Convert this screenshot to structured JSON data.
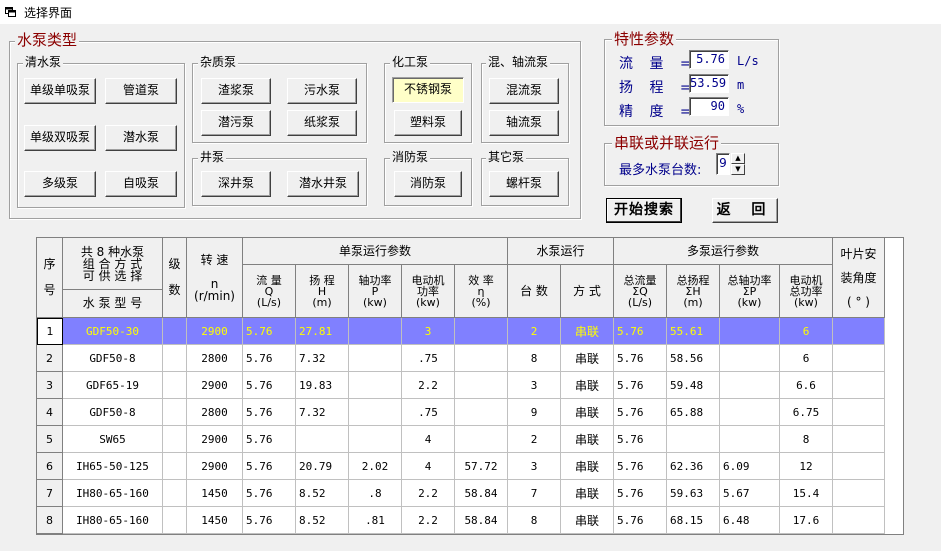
{
  "window": {
    "title": "选择界面"
  },
  "pump_type": {
    "title": "水泵类型",
    "groups": {
      "clear": {
        "label": "清水泵",
        "buttons": [
          "单级单吸泵",
          "管道泵",
          "单级双吸泵",
          "潜水泵",
          "多级泵",
          "自吸泵"
        ]
      },
      "impurity": {
        "label": "杂质泵",
        "buttons": [
          "渣浆泵",
          "污水泵",
          "潜污泵",
          "纸浆泵"
        ]
      },
      "chemical": {
        "label": "化工泵",
        "buttons": [
          "不锈钢泵",
          "塑料泵"
        ]
      },
      "mixed": {
        "label": "混、轴流泵",
        "buttons": [
          "混流泵",
          "轴流泵"
        ]
      },
      "well": {
        "label": "井泵",
        "buttons": [
          "深井泵",
          "潜水井泵"
        ]
      },
      "fire": {
        "label": "消防泵",
        "buttons": [
          "消防泵"
        ]
      },
      "other": {
        "label": "其它泵",
        "buttons": [
          "螺杆泵"
        ]
      }
    },
    "selected": "不锈钢泵"
  },
  "characteristics": {
    "title": "特性参数",
    "flow": {
      "label": "流 量 =",
      "value": "5.76",
      "unit": "L/s"
    },
    "head": {
      "label": "扬 程 =",
      "value": "53.59",
      "unit": "m"
    },
    "precision": {
      "label": "精 度 =",
      "value": "90",
      "unit": "%"
    }
  },
  "series": {
    "title": "串联或并联运行",
    "max_label": "最多水泵台数:",
    "max_value": "9"
  },
  "actions": {
    "search": "开始搜索",
    "back": "返 回"
  },
  "table": {
    "headers": {
      "seq": "序\n\n号",
      "combos": "共 8 种水泵\n组 合 方 式\n可 供 选 择",
      "model": "水 泵 型 号",
      "stage": "级\n\n数",
      "speed": "转  速\n\nn\n(r/min)",
      "single": "单泵运行参数",
      "flow": "流  量\nQ\n(L/s)",
      "head": "扬  程\nH\n(m)",
      "shaft": "轴功率\nP\n(kw)",
      "motor": "电动机\n功率\n(kw)",
      "eff": "效  率\nη\n(%)",
      "pumps": "水泵运行",
      "count": "台  数",
      "mode": "方  式",
      "multi": "多泵运行参数",
      "tflow": "总流量\nΣQ\n(L/s)",
      "thead": "总扬程\nΣH\n(m)",
      "tshaft": "总轴功率\nΣP\n(kw)",
      "tmotor": "电动机\n总功率\n(kw)",
      "blade": "叶片安\n\n装角度\n\n( ° )"
    },
    "rows": [
      {
        "n": "1",
        "model": "GDF50-30",
        "stage": "",
        "speed": "2900",
        "flow": "5.76",
        "head": "27.81",
        "shaft": "",
        "motor": "3",
        "eff": "",
        "count": "2",
        "mode": "串联",
        "tflow": "5.76",
        "thead": "55.61",
        "tshaft": "",
        "tmotor": "6",
        "blade": ""
      },
      {
        "n": "2",
        "model": "GDF50-8",
        "stage": "",
        "speed": "2800",
        "flow": "5.76",
        "head": "7.32",
        "shaft": "",
        "motor": ".75",
        "eff": "",
        "count": "8",
        "mode": "串联",
        "tflow": "5.76",
        "thead": "58.56",
        "tshaft": "",
        "tmotor": "6",
        "blade": ""
      },
      {
        "n": "3",
        "model": "GDF65-19",
        "stage": "",
        "speed": "2900",
        "flow": "5.76",
        "head": "19.83",
        "shaft": "",
        "motor": "2.2",
        "eff": "",
        "count": "3",
        "mode": "串联",
        "tflow": "5.76",
        "thead": "59.48",
        "tshaft": "",
        "tmotor": "6.6",
        "blade": ""
      },
      {
        "n": "4",
        "model": "GDF50-8",
        "stage": "",
        "speed": "2800",
        "flow": "5.76",
        "head": "7.32",
        "shaft": "",
        "motor": ".75",
        "eff": "",
        "count": "9",
        "mode": "串联",
        "tflow": "5.76",
        "thead": "65.88",
        "tshaft": "",
        "tmotor": "6.75",
        "blade": ""
      },
      {
        "n": "5",
        "model": "SW65",
        "stage": "",
        "speed": "2900",
        "flow": "5.76",
        "head": "",
        "shaft": "",
        "motor": "4",
        "eff": "",
        "count": "2",
        "mode": "串联",
        "tflow": "5.76",
        "thead": "",
        "tshaft": "",
        "tmotor": "8",
        "blade": ""
      },
      {
        "n": "6",
        "model": "IH65-50-125",
        "stage": "",
        "speed": "2900",
        "flow": "5.76",
        "head": "20.79",
        "shaft": "2.02",
        "motor": "4",
        "eff": "57.72",
        "count": "3",
        "mode": "串联",
        "tflow": "5.76",
        "thead": "62.36",
        "tshaft": "6.09",
        "tmotor": "12",
        "blade": ""
      },
      {
        "n": "7",
        "model": "IH80-65-160",
        "stage": "",
        "speed": "1450",
        "flow": "5.76",
        "head": "8.52",
        "shaft": ".8",
        "motor": "2.2",
        "eff": "58.84",
        "count": "7",
        "mode": "串联",
        "tflow": "5.76",
        "thead": "59.63",
        "tshaft": "5.67",
        "tmotor": "15.4",
        "blade": ""
      },
      {
        "n": "8",
        "model": "IH80-65-160",
        "stage": "",
        "speed": "1450",
        "flow": "5.76",
        "head": "8.52",
        "shaft": ".81",
        "motor": "2.2",
        "eff": "58.84",
        "count": "8",
        "mode": "串联",
        "tflow": "5.76",
        "thead": "68.15",
        "tshaft": "6.48",
        "tmotor": "17.6",
        "blade": ""
      }
    ],
    "selected_row": 0
  },
  "colors": {
    "selected_row_bg": "#8080ff",
    "selected_row_fg": "#ffff00",
    "group_title": "#8b0000",
    "param_text": "#00008b"
  },
  "icons": {
    "window": "window-icon"
  }
}
